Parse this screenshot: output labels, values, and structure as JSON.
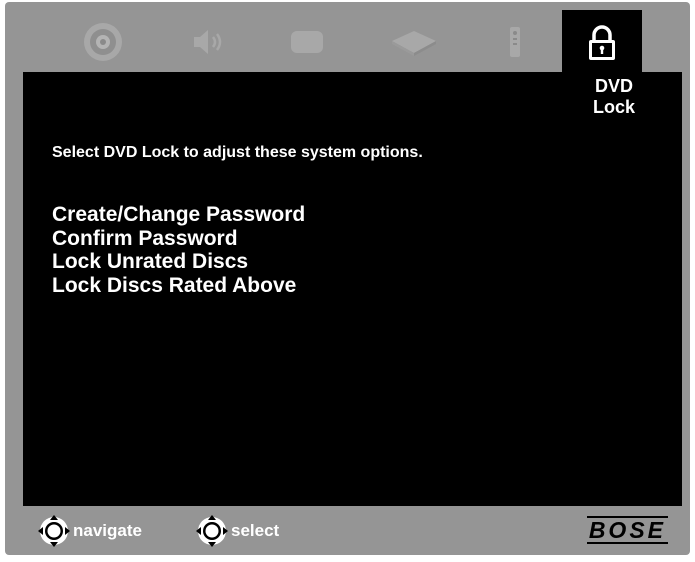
{
  "colors": {
    "frame": "#959595",
    "screen": "#000000",
    "text": "#ffffff",
    "icon_inactive": "#a8a8a8"
  },
  "tabs": [
    {
      "icon": "disc-icon",
      "active": false
    },
    {
      "icon": "speaker-icon",
      "active": false
    },
    {
      "icon": "tv-icon",
      "active": false
    },
    {
      "icon": "dvd-player-icon",
      "active": false
    },
    {
      "icon": "remote-icon",
      "active": false
    },
    {
      "icon": "lock-icon",
      "active": true
    }
  ],
  "active_tab": {
    "label_line1": "DVD",
    "label_line2": "Lock"
  },
  "instruction": "Select DVD Lock to adjust these system options.",
  "menu": {
    "items": [
      "Create/Change Password",
      "Confirm Password",
      "Lock Unrated Discs",
      "Lock Discs Rated Above"
    ]
  },
  "footer": {
    "navigate_label": "navigate",
    "select_label": "select",
    "brand": "BOSE"
  }
}
